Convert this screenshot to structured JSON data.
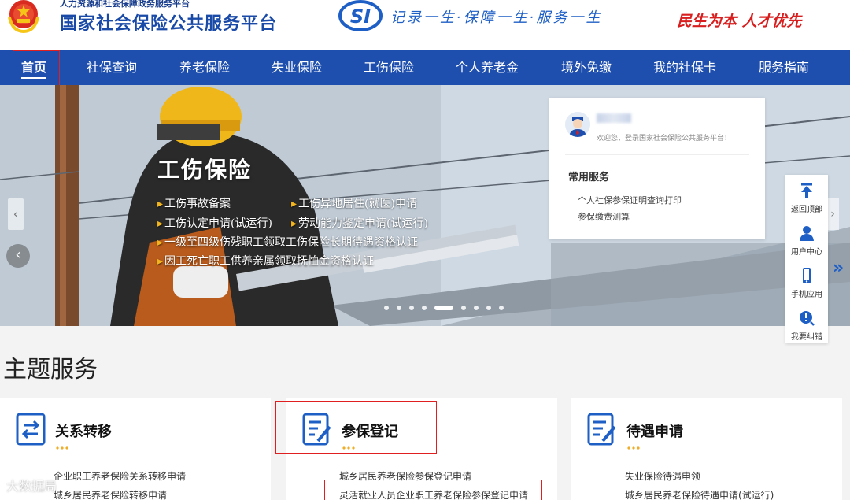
{
  "header": {
    "ministry": "人力资源和社会保障政务服务平台",
    "site_title": "国家社会保险公共服务平台",
    "si_logo_text": "SI",
    "slogan": "记录一生·保障一生·服务一生",
    "motto": "民生为本 人才优先"
  },
  "nav": {
    "items": [
      {
        "label": "首页"
      },
      {
        "label": "社保查询"
      },
      {
        "label": "养老保险"
      },
      {
        "label": "失业保险"
      },
      {
        "label": "工伤保险"
      },
      {
        "label": "个人养老金"
      },
      {
        "label": "境外免缴"
      },
      {
        "label": "我的社保卡"
      },
      {
        "label": "服务指南"
      }
    ],
    "active_index": 0
  },
  "banner": {
    "title": "工伤保险",
    "links": [
      "工伤事故备案",
      "工伤异地居住(就医)申请",
      "工伤认定申请(试运行)",
      "劳动能力鉴定申请(试运行)",
      "一级至四级伤残职工领取工伤保险长期待遇资格认证",
      "因工死亡职工供养亲属领取抚恤金资格认证"
    ],
    "slide_count": 9,
    "active_slide": 4,
    "prev_icon": "‹",
    "next_icon": "›"
  },
  "login_card": {
    "welcome": "欢迎您，登录国家社会保险公共服务平台！",
    "common_title": "常用服务",
    "links": [
      "个人社保参保证明查询打印",
      "参保缴费测算"
    ]
  },
  "side_toolbar": {
    "items": [
      {
        "label": "返回顶部",
        "icon": "arrow-up-icon"
      },
      {
        "label": "用户中心",
        "icon": "user-icon"
      },
      {
        "label": "手机应用",
        "icon": "phone-icon"
      },
      {
        "label": "我要纠错",
        "icon": "error-report-icon"
      }
    ],
    "more_icon": "»"
  },
  "section": {
    "title": "主题服务",
    "cards": [
      {
        "title": "关系转移",
        "icon": "transfer-icon",
        "links": [
          "企业职工养老保险关系转移申请",
          "城乡居民养老保险转移申请"
        ]
      },
      {
        "title": "参保登记",
        "icon": "register-icon",
        "links": [
          "城乡居民养老保险参保登记申请",
          "灵活就业人员企业职工养老保险参保登记申请"
        ]
      },
      {
        "title": "待遇申请",
        "icon": "benefit-icon",
        "links": [
          "失业保险待遇申领",
          "城乡居民养老保险待遇申请(试运行)"
        ]
      }
    ]
  },
  "watermark": "大数据局",
  "colors": {
    "nav_bg": "#1e4fae",
    "title_blue": "#1a4aa8",
    "motto_red": "#d81e1e",
    "highlight_red": "#e02020",
    "accent_orange": "#f2b51e"
  }
}
